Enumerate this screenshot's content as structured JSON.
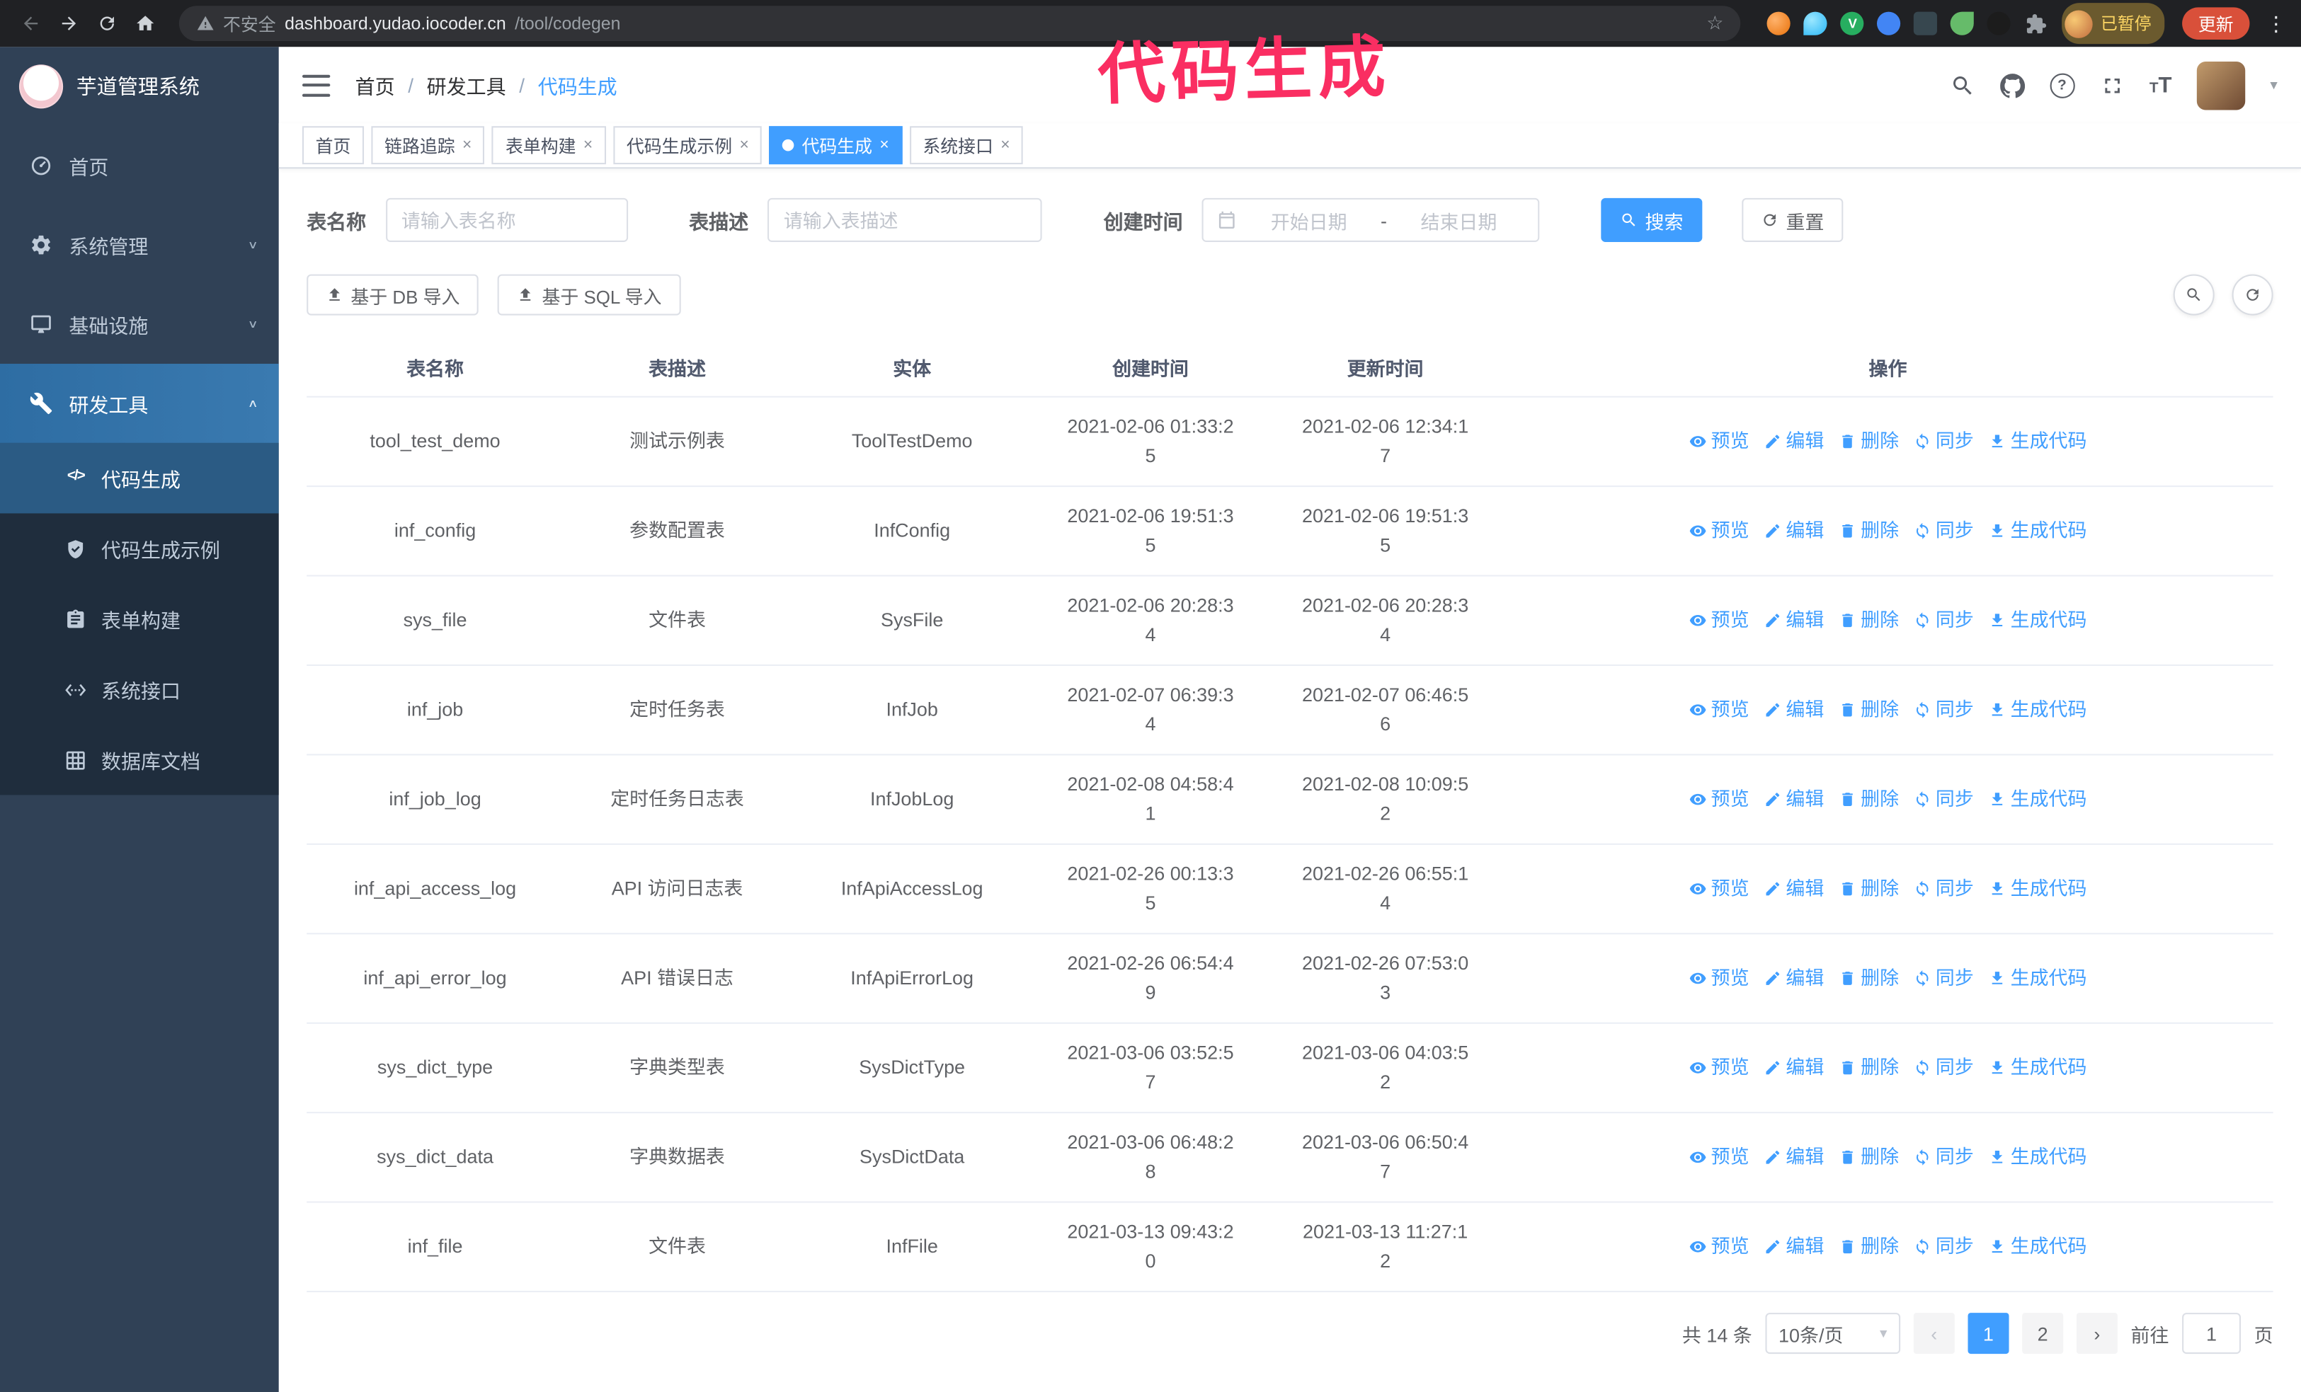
{
  "icons": {
    "star": "☆",
    "kebab": "⋮",
    "chevron_down": "∨",
    "chevron_up": "∧",
    "caret": "▾",
    "prev": "‹",
    "next": "›",
    "close": "×",
    "help": "?",
    "separator": "/",
    "code_glyph": "</>",
    "text": "T"
  },
  "browser": {
    "security_label": "不安全",
    "url_host": "dashboard.yudao.iocoder.cn",
    "url_path": "/tool/codegen",
    "profile_badge": "已暂停",
    "update_button": "更新",
    "extension_icons": [
      "fox-icon",
      "drop-icon",
      "check-icon",
      "people-icon",
      "keyboard-icon",
      "leaf-icon",
      "pug-icon",
      "puzzle-icon"
    ]
  },
  "annotation": {
    "text": "代码生成",
    "color": "#fa2e62"
  },
  "sidebar": {
    "logo_text": "芋道管理系统",
    "items": [
      {
        "label": "首页"
      },
      {
        "label": "系统管理"
      },
      {
        "label": "基础设施"
      },
      {
        "label": "研发工具"
      }
    ],
    "submenu": [
      {
        "label": "代码生成"
      },
      {
        "label": "代码生成示例"
      },
      {
        "label": "表单构建"
      },
      {
        "label": "系统接口"
      },
      {
        "label": "数据库文档"
      }
    ]
  },
  "header": {
    "breadcrumb": [
      "首页",
      "研发工具",
      "代码生成"
    ]
  },
  "tabs": [
    {
      "label": "首页"
    },
    {
      "label": "链路追踪"
    },
    {
      "label": "表单构建"
    },
    {
      "label": "代码生成示例"
    },
    {
      "label": "代码生成",
      "active": true
    },
    {
      "label": "系统接口"
    }
  ],
  "search": {
    "name_label": "表名称",
    "name_placeholder": "请输入表名称",
    "desc_label": "表描述",
    "desc_placeholder": "请输入表描述",
    "time_label": "创建时间",
    "start_placeholder": "开始日期",
    "range_separator": "-",
    "end_placeholder": "结束日期",
    "search_button": "搜索",
    "reset_button": "重置"
  },
  "toolbar": {
    "import_db": "基于 DB 导入",
    "import_sql": "基于 SQL 导入"
  },
  "table": {
    "columns": [
      "表名称",
      "表描述",
      "实体",
      "创建时间",
      "更新时间",
      "操作"
    ],
    "actions": [
      {
        "label": "预览",
        "icon": "eye-icon",
        "ref": "#i-eye"
      },
      {
        "label": "编辑",
        "icon": "edit-icon",
        "ref": "#i-edit"
      },
      {
        "label": "删除",
        "icon": "trash-icon",
        "ref": "#i-del"
      },
      {
        "label": "同步",
        "icon": "sync-icon",
        "ref": "#i-sync"
      },
      {
        "label": "生成代码",
        "icon": "download-icon",
        "ref": "#i-dl"
      }
    ],
    "rows": [
      {
        "name": "tool_test_demo",
        "desc": "测试示例表",
        "entity": "ToolTestDemo",
        "created": "2021-02-06 01:33:25",
        "updated": "2021-02-06 12:34:17"
      },
      {
        "name": "inf_config",
        "desc": "参数配置表",
        "entity": "InfConfig",
        "created": "2021-02-06 19:51:35",
        "updated": "2021-02-06 19:51:35"
      },
      {
        "name": "sys_file",
        "desc": "文件表",
        "entity": "SysFile",
        "created": "2021-02-06 20:28:34",
        "updated": "2021-02-06 20:28:34"
      },
      {
        "name": "inf_job",
        "desc": "定时任务表",
        "entity": "InfJob",
        "created": "2021-02-07 06:39:34",
        "updated": "2021-02-07 06:46:56"
      },
      {
        "name": "inf_job_log",
        "desc": "定时任务日志表",
        "entity": "InfJobLog",
        "created": "2021-02-08 04:58:41",
        "updated": "2021-02-08 10:09:52"
      },
      {
        "name": "inf_api_access_log",
        "desc": "API 访问日志表",
        "entity": "InfApiAccessLog",
        "created": "2021-02-26 00:13:35",
        "updated": "2021-02-26 06:55:14"
      },
      {
        "name": "inf_api_error_log",
        "desc": "API 错误日志",
        "entity": "InfApiErrorLog",
        "created": "2021-02-26 06:54:49",
        "updated": "2021-02-26 07:53:03"
      },
      {
        "name": "sys_dict_type",
        "desc": "字典类型表",
        "entity": "SysDictType",
        "created": "2021-03-06 03:52:57",
        "updated": "2021-03-06 04:03:52"
      },
      {
        "name": "sys_dict_data",
        "desc": "字典数据表",
        "entity": "SysDictData",
        "created": "2021-03-06 06:48:28",
        "updated": "2021-03-06 06:50:47"
      },
      {
        "name": "inf_file",
        "desc": "文件表",
        "entity": "InfFile",
        "created": "2021-03-13 09:43:20",
        "updated": "2021-03-13 11:27:12"
      }
    ]
  },
  "pagination": {
    "total_text": "共 14 条",
    "page_size": "10条/页",
    "pages": [
      "1",
      "2"
    ],
    "active_page": "1",
    "goto_label": "前往",
    "goto_value": "1",
    "goto_suffix": "页"
  },
  "colors": {
    "accent": "#409EFF",
    "sidebar_bg": "#304156",
    "submenu_bg": "#1f2d3d",
    "tab_active_bg": "#409EFF"
  }
}
